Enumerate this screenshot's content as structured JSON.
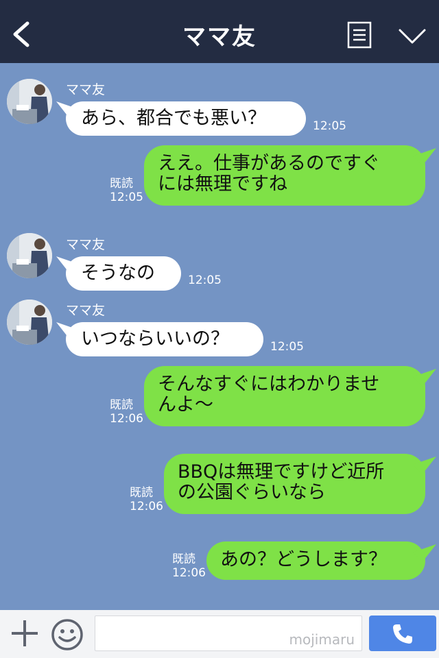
{
  "header": {
    "title": "ママ友",
    "back_icon": "chevron-left-icon",
    "menu_icon": "notes-icon",
    "more_icon": "chevron-down-icon"
  },
  "messages": [
    {
      "side": "in",
      "sender": "ママ友",
      "text": "あら、都合でも悪い？",
      "time": "12:05"
    },
    {
      "side": "out",
      "read": "既読",
      "text": "ええ。仕事があるのですぐ\nには無理ですね",
      "time": "12:05"
    },
    {
      "side": "in",
      "sender": "ママ友",
      "text": "そうなの",
      "time": "12:05"
    },
    {
      "side": "in",
      "sender": "ママ友",
      "text": "いつならいいの？",
      "time": "12:05"
    },
    {
      "side": "out",
      "read": "既読",
      "text": "そんなすぐにはわかりませ\nんよ〜",
      "time": "12:06"
    },
    {
      "side": "out",
      "read": "既読",
      "text": "BBQは無理ですけど近所\nの公園ぐらいなら",
      "time": "12:06"
    },
    {
      "side": "out",
      "read": "既読",
      "text": "あの？どうします？",
      "time": "12:06"
    }
  ],
  "footer": {
    "input_value": "",
    "watermark": "mojimaru",
    "plus_icon": "plus-icon",
    "emoji_icon": "smiley-icon",
    "call_icon": "phone-icon"
  },
  "colors": {
    "header_bg": "#232c42",
    "chat_bg": "#7494c4",
    "outgoing_bubble": "#7fe147",
    "incoming_bubble": "#ffffff",
    "call_button": "#4f86e6"
  }
}
